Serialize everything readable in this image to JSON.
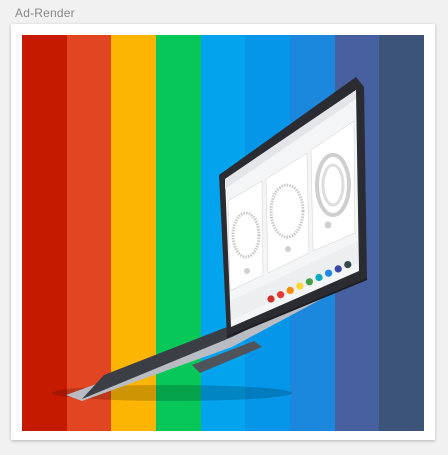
{
  "panel": {
    "title": "Ad-Render"
  },
  "stripes": [
    {
      "color": "#c61a00"
    },
    {
      "color": "#e24521"
    },
    {
      "color": "#fcb502"
    },
    {
      "color": "#07c759"
    },
    {
      "color": "#03a3ee"
    },
    {
      "color": "#0596e9"
    },
    {
      "color": "#1c88dd"
    },
    {
      "color": "#4660a0"
    },
    {
      "color": "#3c5478"
    }
  ],
  "screen_dots": [
    "#d32f2f",
    "#e53935",
    "#fb8c00",
    "#fdd835",
    "#43a047",
    "#00acc1",
    "#1e88e5",
    "#3949ab",
    "#37474f"
  ]
}
